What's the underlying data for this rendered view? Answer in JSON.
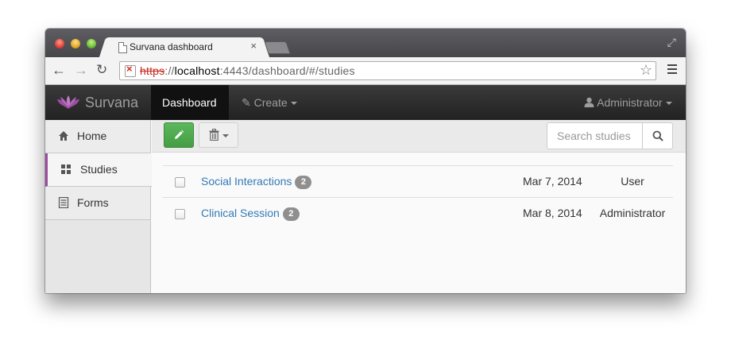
{
  "browser": {
    "tab_title": "Survana dashboard",
    "tab_close": "×",
    "url": {
      "scheme": "https",
      "separator": "://",
      "host": "localhost",
      "rest": ":4443/dashboard/#/studies"
    }
  },
  "navbar": {
    "brand": "Survana",
    "items": [
      {
        "label": "Dashboard",
        "active": true
      },
      {
        "label": "Create",
        "dropdown": true
      }
    ],
    "user": "Administrator"
  },
  "sidebar": {
    "items": [
      {
        "label": "Home",
        "icon": "home-icon"
      },
      {
        "label": "Studies",
        "icon": "grid-icon",
        "active": true
      },
      {
        "label": "Forms",
        "icon": "list-alt-icon"
      }
    ]
  },
  "toolbar": {
    "search_placeholder": "Search studies"
  },
  "studies": {
    "rows": [
      {
        "name": "Social Interactions",
        "count": "2",
        "date": "Mar 7, 2014",
        "owner": "User"
      },
      {
        "name": "Clinical Session",
        "count": "2",
        "date": "Mar 8, 2014",
        "owner": "Administrator"
      }
    ]
  },
  "colors": {
    "accent_purple": "#9b4c9f",
    "success_green": "#5cb85c",
    "link_blue": "#337ab7",
    "navbar_dark": "#222222"
  }
}
